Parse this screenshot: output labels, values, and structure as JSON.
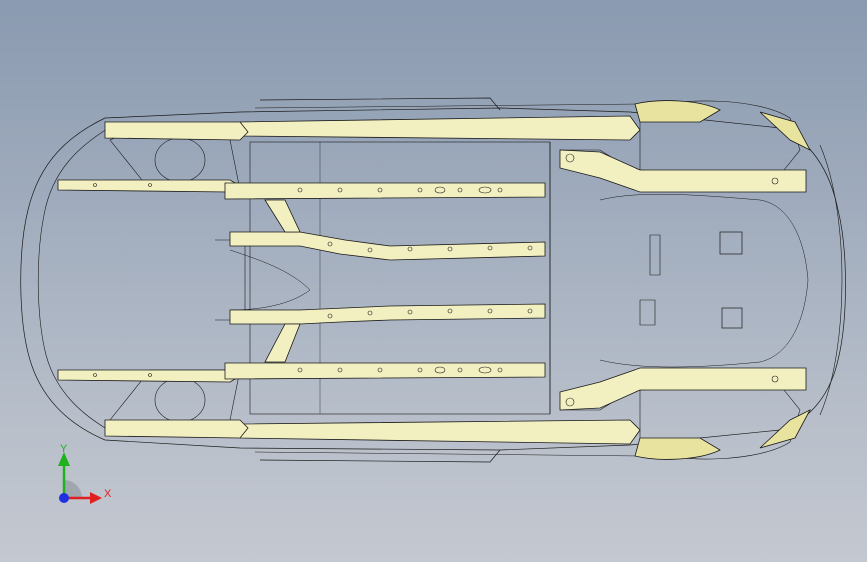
{
  "viewport": {
    "background_top": "#8a9ab0",
    "background_bottom": "#c4c8d0"
  },
  "model": {
    "description_icon": "car-underbody-frame-wireframe",
    "line_color": "#1a1a1a",
    "fill_color": "#f2f0c0",
    "accent_fill": "#e8e4a0"
  },
  "triad": {
    "x_label": "X",
    "y_label": "Y",
    "x_color": "#e02020",
    "y_color": "#20b020",
    "z_color": "#2030e0"
  }
}
